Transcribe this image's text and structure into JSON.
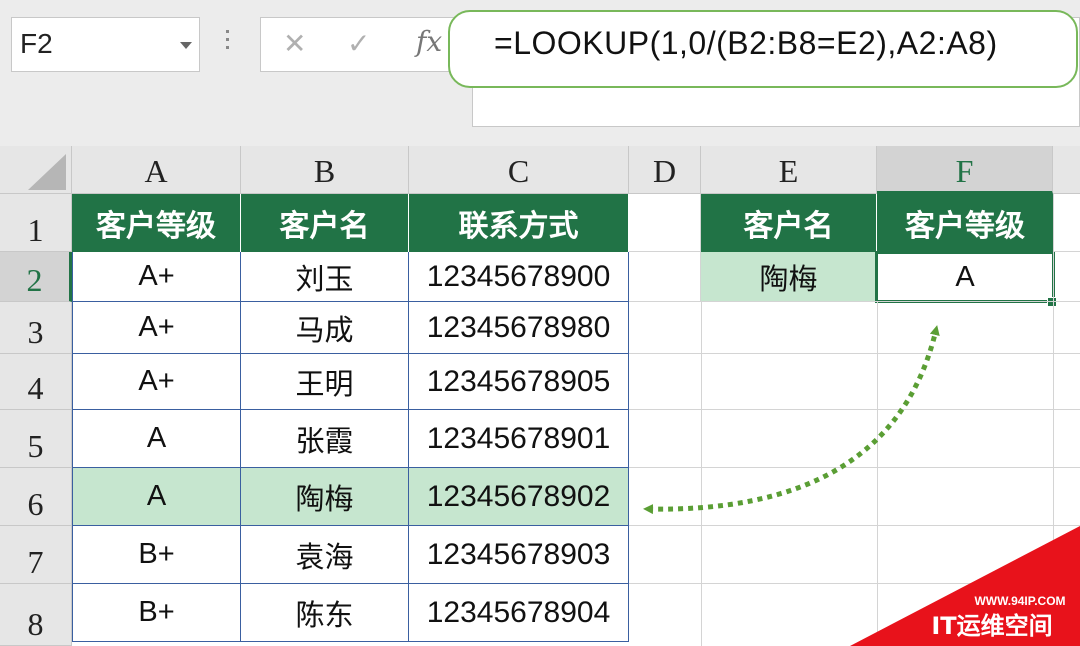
{
  "formula_bar": {
    "name_box": "F2",
    "cancel_glyph": "✕",
    "enter_glyph": "✓",
    "fx_label": "fx",
    "formula": "=LOOKUP(1,0/(B2:B8=E2),A2:A8)"
  },
  "columns": [
    "A",
    "B",
    "C",
    "D",
    "E",
    "F"
  ],
  "rows": [
    "1",
    "2",
    "3",
    "4",
    "5",
    "6",
    "7",
    "8"
  ],
  "table": {
    "headers": [
      "客户等级",
      "客户名",
      "联系方式"
    ],
    "rows": [
      [
        "A+",
        "刘玉",
        "12345678900"
      ],
      [
        "A+",
        "马成",
        "12345678980"
      ],
      [
        "A+",
        "王明",
        "12345678905"
      ],
      [
        "A",
        "张霞",
        "12345678901"
      ],
      [
        "A",
        "陶梅",
        "12345678902"
      ],
      [
        "B+",
        "袁海",
        "12345678903"
      ],
      [
        "B+",
        "陈东",
        "12345678904"
      ]
    ]
  },
  "lookup": {
    "headers": [
      "客户名",
      "客户等级"
    ],
    "name": "陶梅",
    "result": "A"
  },
  "colors": {
    "header_green": "#217346",
    "highlight_green": "#c6e6cf",
    "arrow_green": "#5a9e34",
    "formula_outline": "#78b85a",
    "watermark_red": "#e8121b"
  },
  "watermark": {
    "url": "WWW.94IP.COM",
    "brand": "IT运维空间"
  }
}
